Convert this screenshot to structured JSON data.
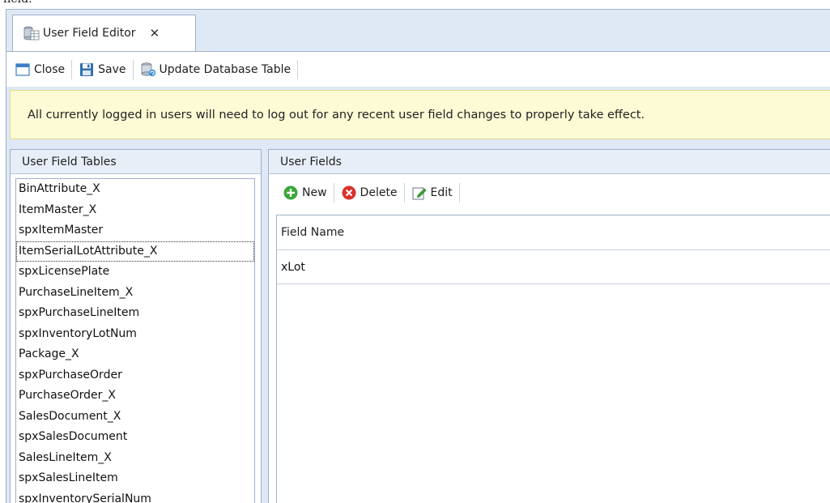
{
  "caption": "field.",
  "tab": {
    "label": "User Field Editor",
    "close_glyph": "✕",
    "icon": "database-table-icon"
  },
  "toolbar": {
    "close_label": "Close",
    "save_label": "Save",
    "update_label": "Update Database Table"
  },
  "banner": {
    "message": "All currently logged in users will need to log out for any recent user field changes to properly take effect."
  },
  "left_panel": {
    "title": "User Field Tables",
    "selected_index": 3,
    "items": [
      "BinAttribute_X",
      "ItemMaster_X",
      "spxItemMaster",
      "ItemSerialLotAttribute_X",
      "spxLicensePlate",
      "PurchaseLineItem_X",
      "spxPurchaseLineItem",
      "spxInventoryLotNum",
      "Package_X",
      "spxPurchaseOrder",
      "PurchaseOrder_X",
      "SalesDocument_X",
      "spxSalesDocument",
      "SalesLineItem_X",
      "spxSalesLineItem",
      "spxInventorySerialNum"
    ]
  },
  "right_panel": {
    "title": "User Fields",
    "new_label": "New",
    "delete_label": "Delete",
    "edit_label": "Edit",
    "grid": {
      "columns": [
        "Field Name"
      ],
      "rows": [
        [
          "xLot"
        ]
      ]
    }
  },
  "colors": {
    "window_bg": "#dfe8f5",
    "border": "#9fb1c9",
    "banner_bg": "#fdfbd5",
    "new_green": "#3aa63a",
    "delete_red": "#d9302b"
  }
}
